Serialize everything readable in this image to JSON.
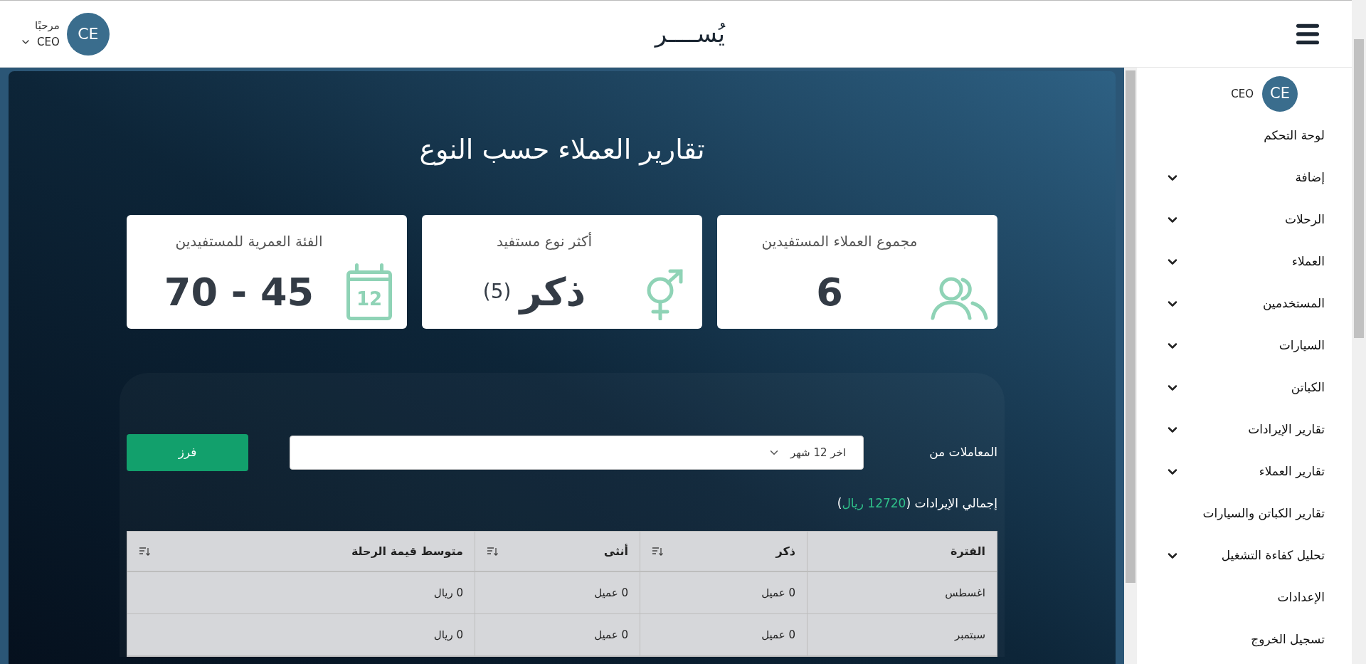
{
  "header": {
    "brand": "يُســــر",
    "greeting": "مرحبًا",
    "user": "CEO",
    "avatar": "CE"
  },
  "sidebar": {
    "avatar": "CE",
    "user": "CEO",
    "items": [
      {
        "label": "لوحة التحكم",
        "has_submenu": false
      },
      {
        "label": "إضافة",
        "has_submenu": true
      },
      {
        "label": "الرحلات",
        "has_submenu": true
      },
      {
        "label": "العملاء",
        "has_submenu": true
      },
      {
        "label": "المستخدمين",
        "has_submenu": true
      },
      {
        "label": "السيارات",
        "has_submenu": true
      },
      {
        "label": "الكباتن",
        "has_submenu": true
      },
      {
        "label": "تقارير الإيرادات",
        "has_submenu": true
      },
      {
        "label": "تقارير العملاء",
        "has_submenu": true
      },
      {
        "label": "تقارير الكباتن والسيارات",
        "has_submenu": false
      },
      {
        "label": "تحليل كفاءة التشغيل",
        "has_submenu": true
      },
      {
        "label": "الإعدادات",
        "has_submenu": false
      },
      {
        "label": "تسجيل الخروج",
        "has_submenu": false
      }
    ]
  },
  "page_title": "تقارير العملاء حسب النوع",
  "cards": [
    {
      "kind": "users",
      "label": "مجموع العملاء المستفيدين",
      "value": "6"
    },
    {
      "kind": "gender",
      "label": "أكثر نوع مستفيد",
      "value": "ذكر",
      "count": "(5)"
    },
    {
      "kind": "calendar",
      "label": "الفئة العمرية للمستفيدين",
      "value": "45 - 70",
      "icon_label": "12"
    }
  ],
  "filter": {
    "label": "المعاملات من",
    "value": "اخر 12 شهر",
    "button": "فرز"
  },
  "revenue": {
    "label": "إجمالي الإيرادات (",
    "amount": "12720 ريال",
    "suffix": ")"
  },
  "table": {
    "columns": [
      {
        "label": "الفترة",
        "sortable": false
      },
      {
        "label": "ذكر",
        "sortable": true
      },
      {
        "label": "أنثى",
        "sortable": true
      },
      {
        "label": "متوسط قيمة الرحلة",
        "sortable": true
      }
    ],
    "rows": [
      [
        "اغسطس",
        "0 عميل",
        "0 عميل",
        "0 ريال"
      ],
      [
        "سبتمبر",
        "0 عميل",
        "0 عميل",
        "0 ريال"
      ]
    ]
  }
}
